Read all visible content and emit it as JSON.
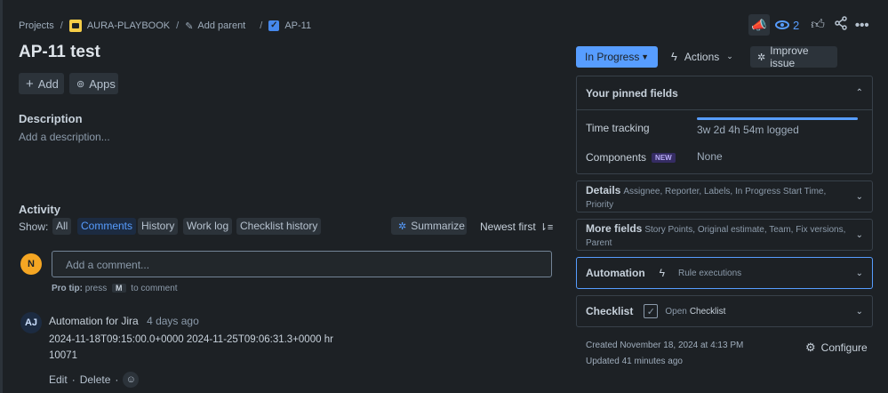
{
  "breadcrumb": {
    "projects": "Projects",
    "project_name": "AURA-PLAYBOOK",
    "add_parent": "Add parent",
    "issue_key": "AP-11",
    "sep": "/"
  },
  "header": {
    "watch_count": "2"
  },
  "issue": {
    "title": "AP-11 test",
    "add_label": "Add",
    "apps_label": "Apps"
  },
  "description": {
    "heading": "Description",
    "placeholder": "Add a description..."
  },
  "activity": {
    "heading": "Activity",
    "show_label": "Show:",
    "tabs": [
      "All",
      "Comments",
      "History",
      "Work log",
      "Checklist history"
    ],
    "active_tab": "Comments",
    "summarize": "Summarize",
    "sort": "Newest first"
  },
  "comment_input": {
    "avatar_initial": "N",
    "placeholder": "Add a comment...",
    "pro_tip_prefix": "Pro tip:",
    "pro_tip_press": "press",
    "pro_tip_key": "M",
    "pro_tip_suffix": "to comment"
  },
  "comment": {
    "avatar_initials": "AJ",
    "author": "Automation for Jira",
    "time": "4 days ago",
    "line1": "2024-11-18T09:15:00.0+0000 2024-11-25T09:06:31.3+0000 hr",
    "line2": "10071",
    "edit": "Edit",
    "delete": "Delete",
    "dot": "·"
  },
  "right": {
    "status": "In Progress",
    "actions": "Actions",
    "improve": "Improve issue",
    "pinned": {
      "title": "Your pinned fields",
      "time_tracking_label": "Time tracking",
      "time_tracking_value": "3w 2d 4h 54m logged",
      "time_tracking_progress": 1.0,
      "components_label": "Components",
      "components_badge": "NEW",
      "components_value": "None"
    },
    "details": {
      "title": "Details",
      "sub": "Assignee, Reporter, Labels, In Progress Start Time, Priority"
    },
    "more_fields": {
      "title": "More fields",
      "sub": "Story Points, Original estimate, Team, Fix versions, Parent"
    },
    "automation": {
      "title": "Automation",
      "sub": "Rule executions"
    },
    "checklist": {
      "title": "Checklist",
      "open": "Open",
      "checklist_word": "Checklist"
    },
    "created": "Created November 18, 2024 at 4:13 PM",
    "updated": "Updated 41 minutes ago",
    "configure": "Configure"
  },
  "colors": {
    "accent": "#579dff",
    "background": "#1d2125",
    "warning_avatar": "#f5a623"
  }
}
